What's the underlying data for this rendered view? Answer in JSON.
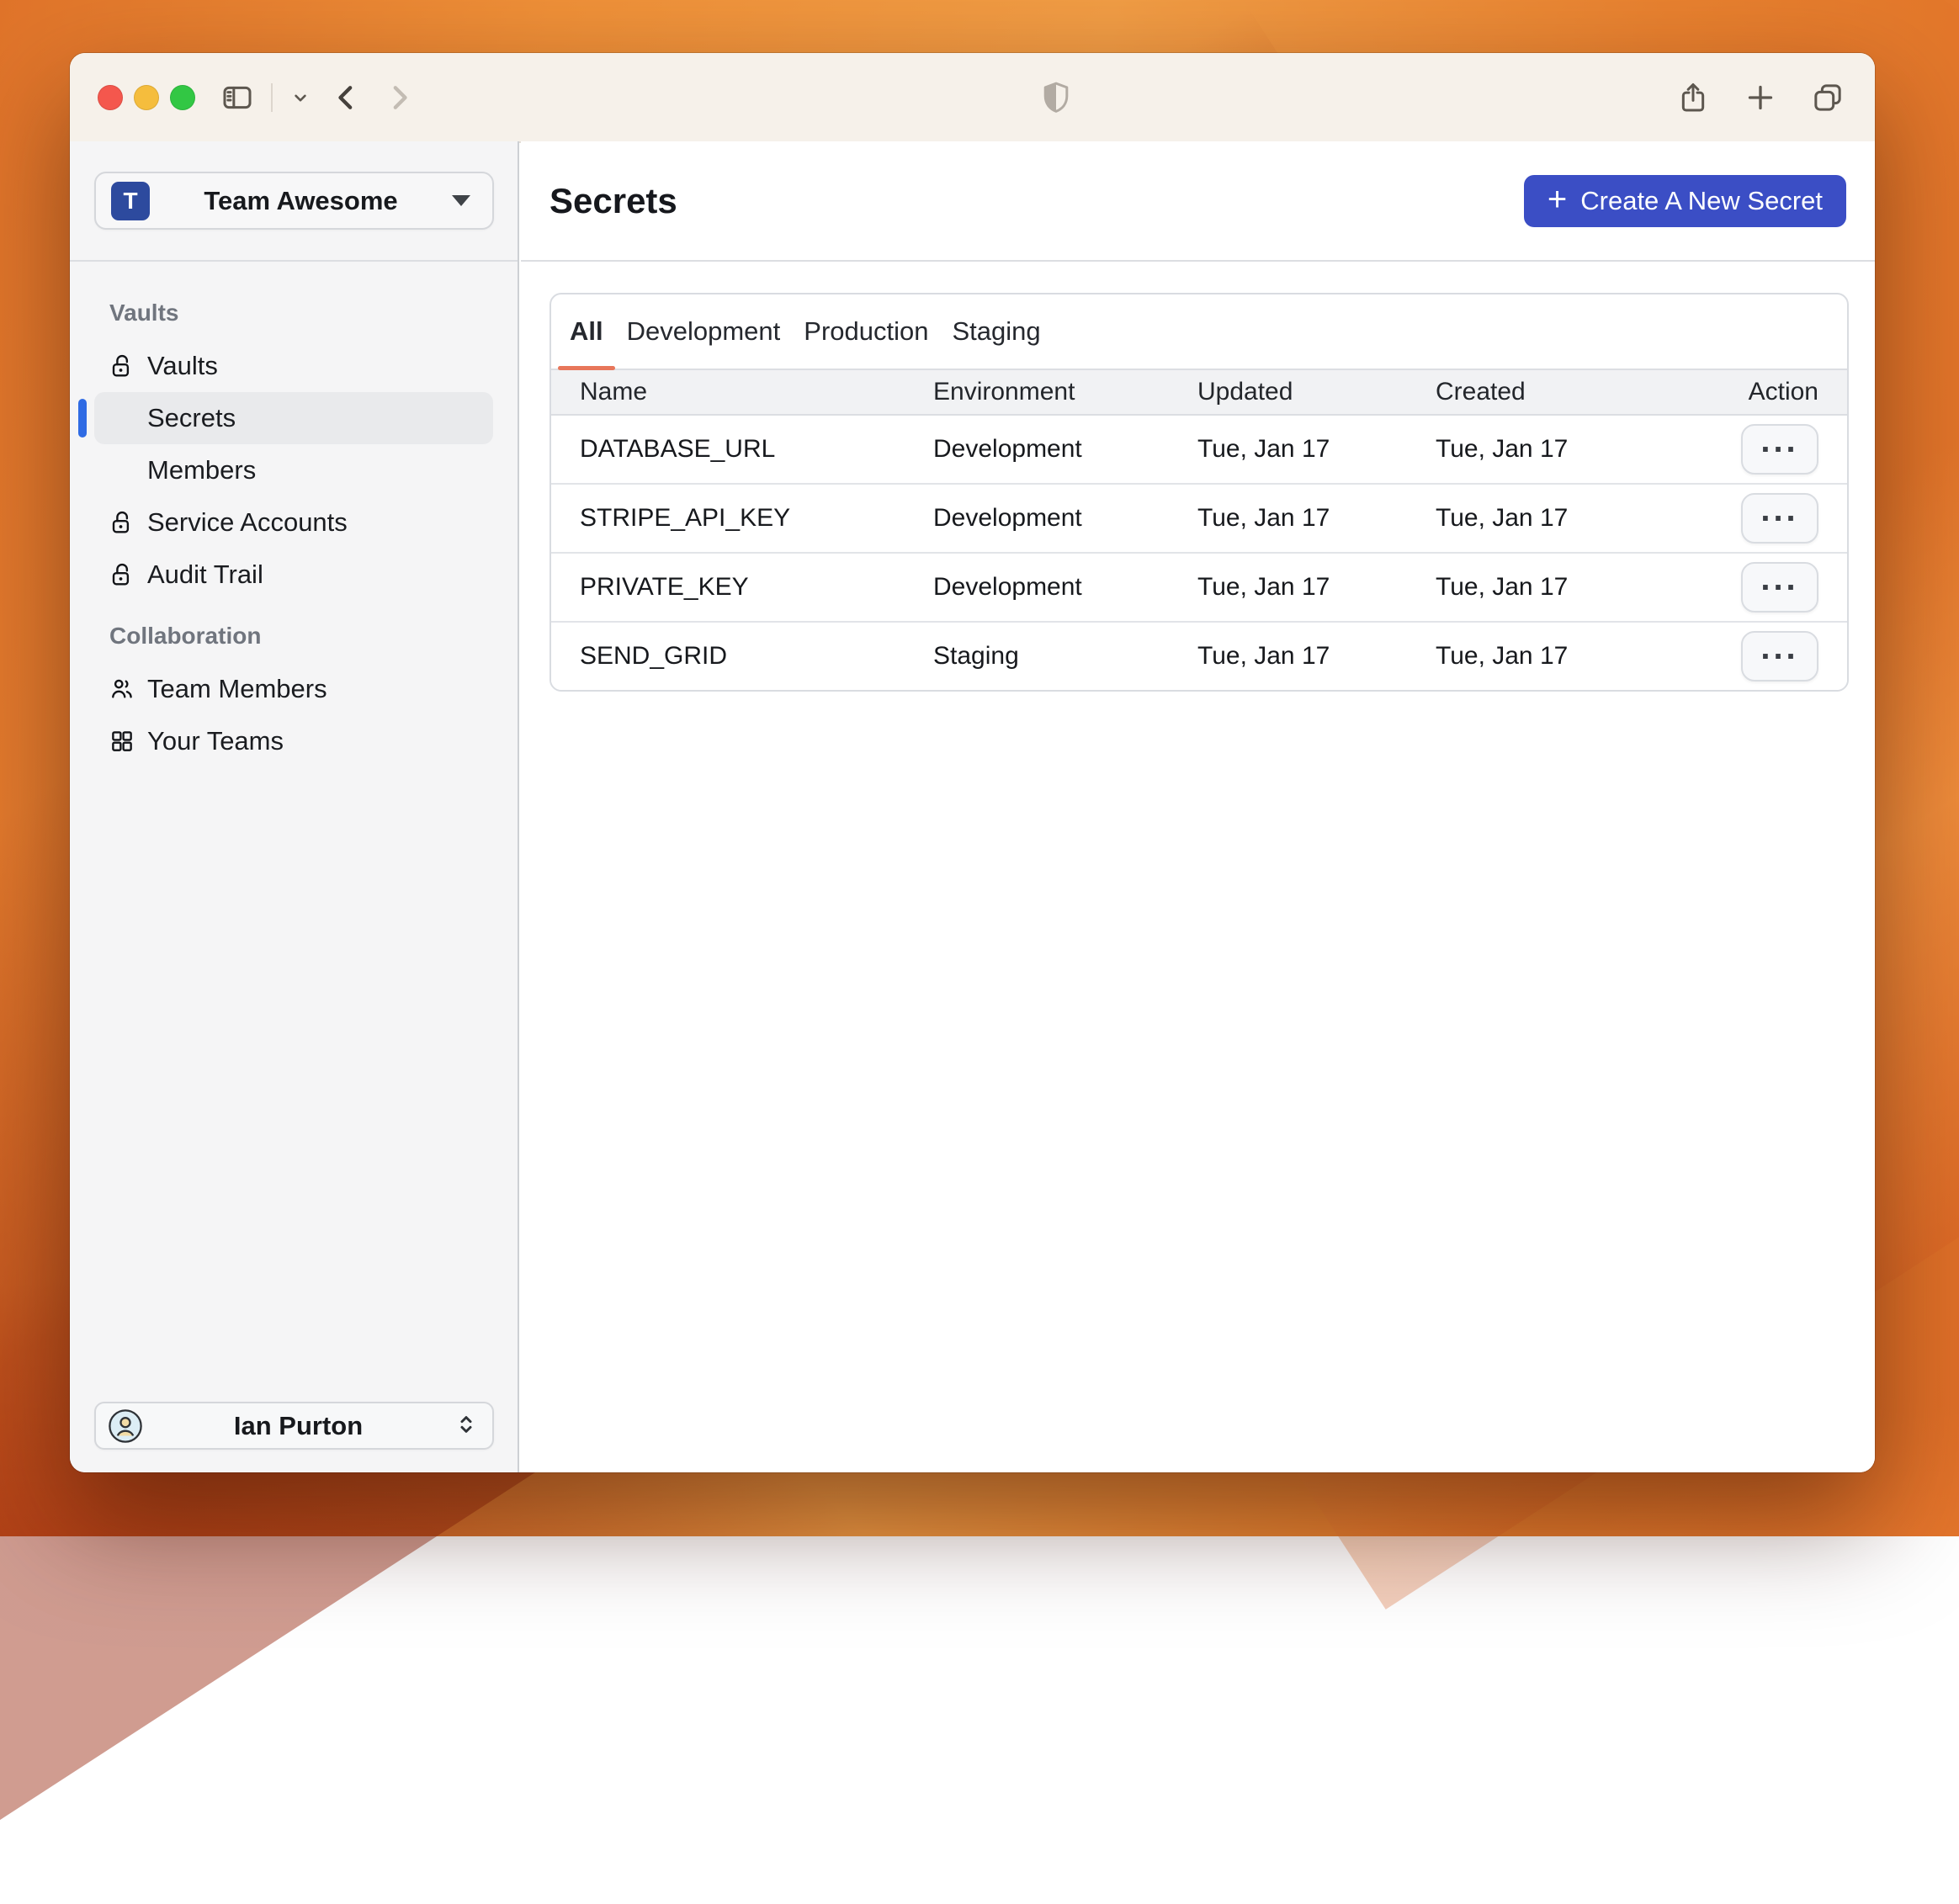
{
  "colors": {
    "accent_blue": "#3b4ec5",
    "team_avatar_blue": "#2d4a9e",
    "selected_bar_blue": "#2f6be4",
    "tab_underline_orange": "#e8765a"
  },
  "sidebar": {
    "team_switcher": {
      "avatar_letter": "T",
      "label": "Team Awesome"
    },
    "sections": [
      {
        "label": "Vaults",
        "items": [
          {
            "label": "Vaults",
            "icon": "lock-open"
          },
          {
            "label": "Secrets",
            "selected": true
          },
          {
            "label": "Members"
          },
          {
            "label": "Service Accounts",
            "icon": "lock-open"
          },
          {
            "label": "Audit Trail",
            "icon": "lock-open"
          }
        ]
      },
      {
        "label": "Collaboration",
        "items": [
          {
            "label": "Team Members",
            "icon": "people"
          },
          {
            "label": "Your Teams",
            "icon": "grid"
          }
        ]
      }
    ],
    "user": {
      "name": "Ian Purton"
    }
  },
  "main": {
    "title": "Secrets",
    "create_button_label": "Create A New Secret",
    "tabs": [
      {
        "label": "All",
        "active": true
      },
      {
        "label": "Development"
      },
      {
        "label": "Production"
      },
      {
        "label": "Staging"
      }
    ],
    "table": {
      "columns": [
        "Name",
        "Environment",
        "Updated",
        "Created",
        "Action"
      ],
      "action_label": "...",
      "rows": [
        {
          "name": "DATABASE_URL",
          "environment": "Development",
          "updated": "Tue, Jan 17",
          "created": "Tue, Jan 17"
        },
        {
          "name": "STRIPE_API_KEY",
          "environment": "Development",
          "updated": "Tue, Jan 17",
          "created": "Tue, Jan 17"
        },
        {
          "name": "PRIVATE_KEY",
          "environment": "Development",
          "updated": "Tue, Jan 17",
          "created": "Tue, Jan 17"
        },
        {
          "name": "SEND_GRID",
          "environment": "Staging",
          "updated": "Tue, Jan 17",
          "created": "Tue, Jan 17"
        }
      ]
    }
  }
}
